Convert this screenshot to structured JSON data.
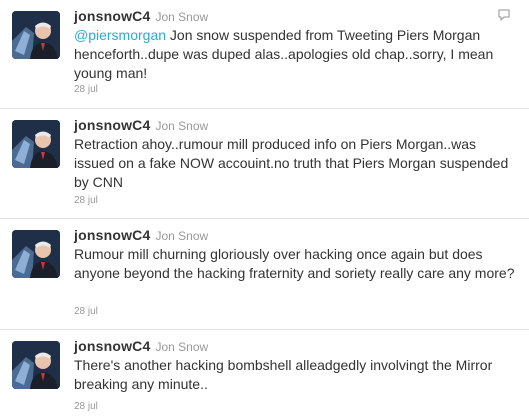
{
  "tweets": [
    {
      "screen_name": "jonsnowC4",
      "full_name": "Jon Snow",
      "mention": "@piersmorgan",
      "text": " Jon snow suspended from Tweeting Piers Morgan henceforth..dupe was duped alas..apologies old chap..sorry, I mean young man!",
      "time": "28 jul"
    },
    {
      "screen_name": "jonsnowC4",
      "full_name": "Jon Snow",
      "mention": "",
      "text": "Retraction ahoy..rumour mill produced info on Piers Morgan..was issued on a fake NOW accouint.no truth that Piers Morgan suspended by CNN",
      "time": "28 jul"
    },
    {
      "screen_name": "jonsnowC4",
      "full_name": "Jon Snow",
      "mention": "",
      "text": "Rumour mill churning gloriously over hacking once again but does anyone beyond the hacking fraternity and soriety really care any more?",
      "time": "28 jul"
    },
    {
      "screen_name": "jonsnowC4",
      "full_name": "Jon Snow",
      "mention": "",
      "text": "There's another hacking bombshell alleadgedly involvingt the Mirror breaking any minute..",
      "time": "28 jul"
    }
  ],
  "colors": {
    "mention": "#2fa8d4",
    "text": "#333333",
    "muted": "#999999"
  },
  "icons": {
    "avatar": "avatar",
    "reply": "reply-icon"
  }
}
